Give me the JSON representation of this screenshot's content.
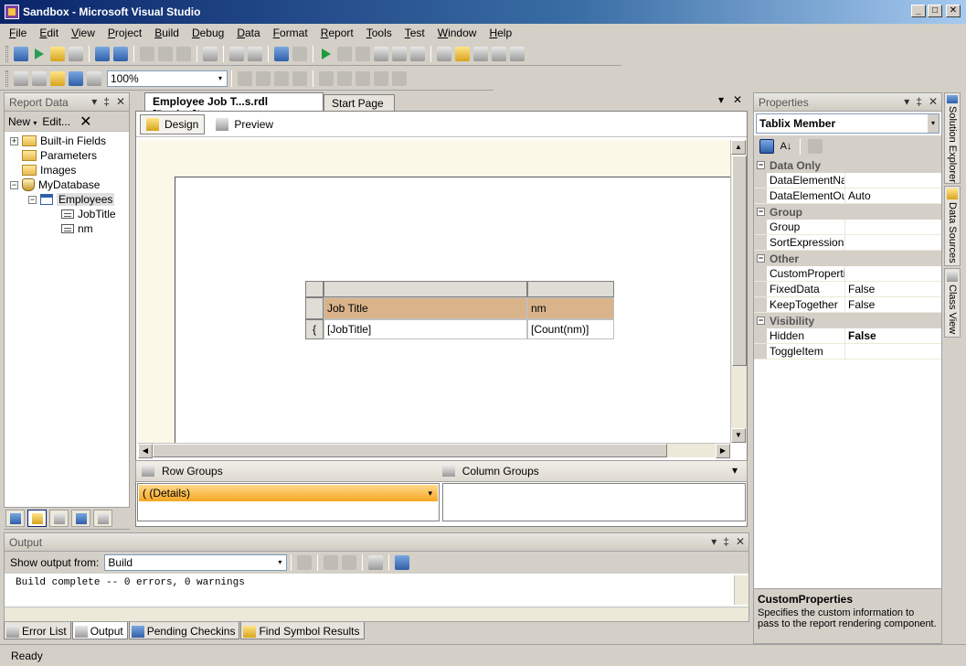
{
  "window": {
    "title": "Sandbox - Microsoft Visual Studio"
  },
  "menu": [
    "File",
    "Edit",
    "View",
    "Project",
    "Build",
    "Debug",
    "Data",
    "Format",
    "Report",
    "Tools",
    "Test",
    "Window",
    "Help"
  ],
  "toolbar": {
    "zoom": "100%"
  },
  "report_data": {
    "title": "Report Data",
    "new_label": "New",
    "edit_label": "Edit...",
    "tree": [
      {
        "label": "Built-in Fields"
      },
      {
        "label": "Parameters"
      },
      {
        "label": "Images"
      },
      {
        "label": "MyDatabase"
      },
      {
        "label": "Employees"
      },
      {
        "label": "JobTitle"
      },
      {
        "label": "nm"
      }
    ]
  },
  "doc_tabs": [
    {
      "label": "Employee Job T...s.rdl [Design]*"
    },
    {
      "label": "Start Page"
    }
  ],
  "design_tabs": [
    {
      "label": "Design"
    },
    {
      "label": "Preview"
    }
  ],
  "tablix": {
    "header": [
      "Job Title",
      "nm"
    ],
    "detail": [
      "[JobTitle]",
      "[Count(nm)]"
    ],
    "row_handle": "{"
  },
  "groups": {
    "row_label": "Row Groups",
    "col_label": "Column Groups",
    "row_items": [
      "( (Details)"
    ]
  },
  "output": {
    "title": "Output",
    "show_from_label": "Show output from:",
    "source": "Build",
    "text": "Build complete -- 0 errors, 0 warnings"
  },
  "bottom_tabs": [
    {
      "label": "Error List"
    },
    {
      "label": "Output"
    },
    {
      "label": "Pending Checkins"
    },
    {
      "label": "Find Symbol Results"
    }
  ],
  "properties": {
    "title": "Properties",
    "object": "Tablix Member",
    "categories": [
      {
        "name": "Data Only",
        "rows": [
          {
            "name": "DataElementNam",
            "value": ""
          },
          {
            "name": "DataElementOutp",
            "value": "Auto"
          }
        ]
      },
      {
        "name": "Group",
        "rows": [
          {
            "name": "Group",
            "value": ""
          },
          {
            "name": "SortExpressions",
            "value": ""
          }
        ]
      },
      {
        "name": "Other",
        "rows": [
          {
            "name": "CustomPropertie",
            "value": ""
          },
          {
            "name": "FixedData",
            "value": "False"
          },
          {
            "name": "KeepTogether",
            "value": "False"
          }
        ]
      },
      {
        "name": "Visibility",
        "rows": [
          {
            "name": "Hidden",
            "value": "False"
          },
          {
            "name": "ToggleItem",
            "value": ""
          }
        ]
      }
    ],
    "desc_title": "CustomProperties",
    "desc_text": "Specifies the custom information to pass to the report rendering component."
  },
  "side_tabs": [
    {
      "label": "Solution Explorer"
    },
    {
      "label": "Data Sources"
    },
    {
      "label": "Class View"
    }
  ],
  "status": "Ready",
  "panel_ctrl": {
    "dropdown": "▾",
    "pin": "‡",
    "close": "✕"
  },
  "window_ctrl": {
    "minimize": "_",
    "maximize": "□",
    "close": "✕"
  },
  "glyphs": {
    "expand": "+",
    "collapse": "−",
    "sort_alpha": "A↓"
  }
}
